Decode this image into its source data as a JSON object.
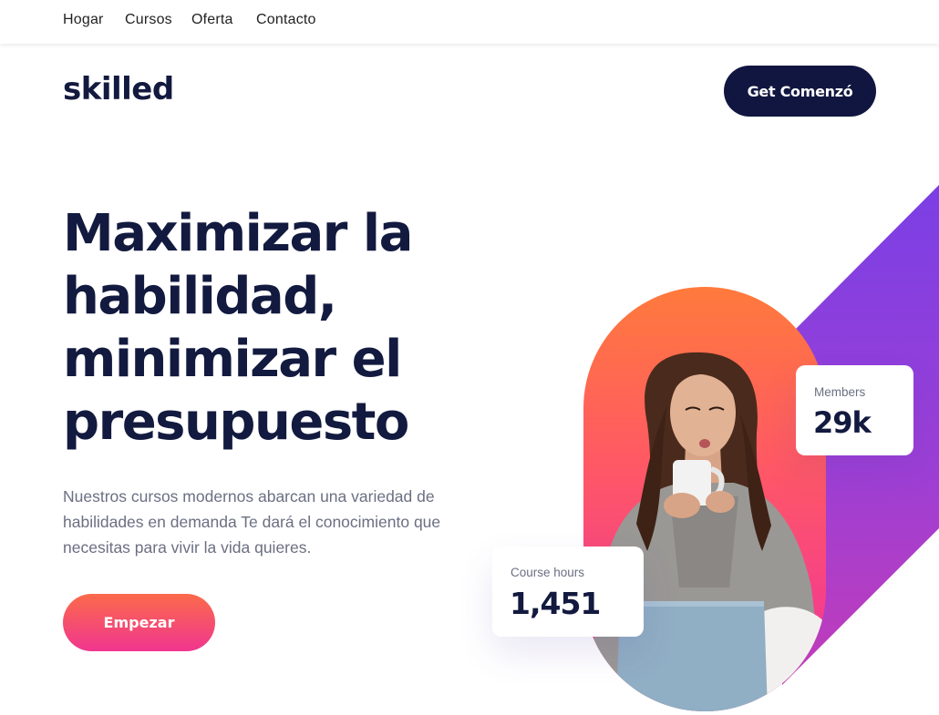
{
  "nav": {
    "items": [
      {
        "label": "Hogar"
      },
      {
        "label": "Cursos"
      },
      {
        "label": "Oferta"
      },
      {
        "label": "Contacto"
      }
    ]
  },
  "header": {
    "logo": "skilled",
    "cta_label": "Get Comenzó"
  },
  "hero": {
    "title": "Maximizar la habilidad, minimizar el presupuesto",
    "description": "Nuestros cursos modernos abarcan una variedad de habilidades en demanda Te dará el conocimiento que necesitas para vivir la vida quieres.",
    "cta_label": "Empezar"
  },
  "stats": {
    "members": {
      "label": "Members",
      "value": "29k"
    },
    "course_hours": {
      "label": "Course hours",
      "value": "1,451"
    }
  },
  "colors": {
    "primary": "#131a3f",
    "cta_dark": "#111640",
    "gradient_start": "#fb6a4a",
    "gradient_end": "#f0368f",
    "accent_purple": "#7b3fe4"
  },
  "media": {
    "hero_image": "woman-with-coffee-photo"
  }
}
